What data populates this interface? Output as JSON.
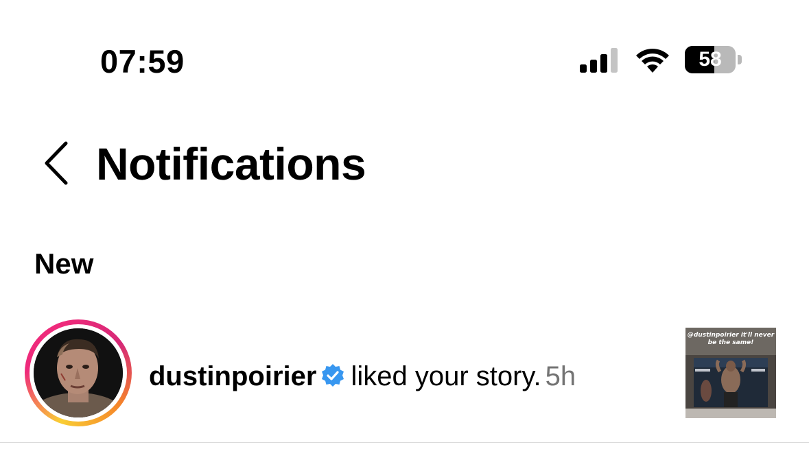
{
  "status_bar": {
    "time": "07:59",
    "battery_level": "58",
    "battery_fraction": 0.58,
    "icons": [
      "cellular-signal-icon",
      "wifi-icon",
      "battery-icon"
    ]
  },
  "header": {
    "back_icon": "chevron-left-icon",
    "title": "Notifications"
  },
  "sections": [
    {
      "title": "New",
      "notifications": [
        {
          "username": "dustinpoirier",
          "verified": true,
          "action": "liked your story.",
          "time": "5h",
          "thumbnail_caption": "@dustinpoirier it'll never be the same!"
        }
      ]
    }
  ],
  "colors": {
    "verified_badge": "#3897f0",
    "time_text": "#737373",
    "story_ring_start": "#f9ce34",
    "story_ring_end": "#ee2a7b"
  }
}
